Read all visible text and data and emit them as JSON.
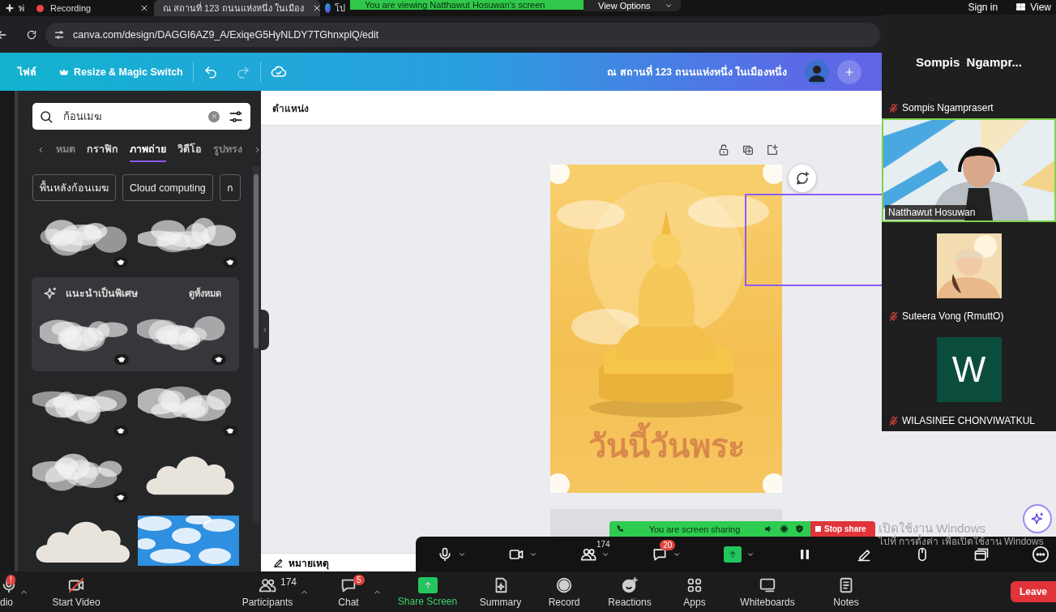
{
  "browser": {
    "tabs": [
      {
        "label": "พ่",
        "selected": false
      },
      {
        "label": "ณ สถานที่ 123 ถนนแห่งหนึ่ง ในเมือง",
        "selected": true
      },
      {
        "label": "โป",
        "selected": false
      }
    ],
    "recording": "Recording",
    "address": "canva.com/design/DAGGI6AZ9_A/ExiqeG5HyNLDY7TGhnxplQ/edit"
  },
  "viewing_banner": {
    "text": "You are viewing Natthawut Hosuwan's screen",
    "options": "View Options"
  },
  "canva_header": {
    "menu": "ไฟล์",
    "resize": "Resize & Magic Switch",
    "title": "ณ สถานที่ 123 ถนนแห่งหนึ่ง ในเมืองหนึ่ง"
  },
  "panel": {
    "search": "ก้อนเมฆ",
    "categories": [
      {
        "label": "หมด",
        "selected": false
      },
      {
        "label": "กราฟิก",
        "selected": false
      },
      {
        "label": "ภาพถ่าย",
        "selected": true
      },
      {
        "label": "วิดีโอ",
        "selected": false
      },
      {
        "label": "รูปทรง",
        "selected": false
      }
    ],
    "chips": [
      "พื้นหลังก้อนเมฆ",
      "Cloud computing",
      "ก"
    ],
    "results_top": [
      {
        "kind": "cloud",
        "premium": true
      },
      {
        "kind": "cloud",
        "premium": true
      }
    ],
    "featured": {
      "title": "แนะนำเป็นพิเศษ",
      "see_all": "ดูทั้งหมด",
      "results": [
        {
          "kind": "cloud",
          "premium": true
        },
        {
          "kind": "cloud",
          "premium": true
        }
      ]
    },
    "results": [
      {
        "kind": "cloud",
        "premium": true
      },
      {
        "kind": "cloud",
        "premium": true
      },
      {
        "kind": "cloud",
        "premium": true
      },
      {
        "kind": "shape",
        "premium": false
      },
      {
        "kind": "shape",
        "premium": false
      },
      {
        "kind": "sky",
        "premium": false
      }
    ]
  },
  "canvas": {
    "toolbar_label": "ตำแหน่ง",
    "poster_title": "วันนี้วันพระ",
    "notes": "หมายเหตุ"
  },
  "gallery": {
    "header": [
      "Sign in",
      "View"
    ],
    "tiles": [
      {
        "kind": "name",
        "display": "Sompis  Ngampr...",
        "name": "Sompis Ngamprasert",
        "muted": true,
        "speaking": false
      },
      {
        "kind": "video",
        "name": "Natthawut Hosuwan",
        "muted": false,
        "speaking": true
      },
      {
        "kind": "avatar",
        "name": "Suteera Vong (RmuttO)",
        "muted": true,
        "speaking": false
      },
      {
        "kind": "initial",
        "initial": "W",
        "name": "WILASINEE CHONVIWATKUL",
        "muted": true,
        "speaking": false
      }
    ]
  },
  "share_toolbar": {
    "items": [
      {
        "kind": "mic"
      },
      {
        "kind": "video"
      },
      {
        "kind": "participants",
        "count": "174"
      },
      {
        "kind": "chat",
        "badge": "20"
      },
      {
        "kind": "share"
      },
      {
        "kind": "pause"
      },
      {
        "kind": "annotate"
      },
      {
        "kind": "remote"
      },
      {
        "kind": "window"
      },
      {
        "kind": "more"
      }
    ]
  },
  "share_banner": {
    "text": "You are screen sharing",
    "stop": "Stop share"
  },
  "activation": [
    "เปิดใช้งาน Windows",
    "ไปที่ การตั้งค่า เพื่อเปิดใช้งาน Windows"
  ],
  "meeting_controls": [
    {
      "kind": "audio",
      "label": "dio",
      "badge": "!"
    },
    {
      "kind": "video",
      "label": "Start Video"
    },
    {
      "kind": "participants",
      "label": "Participants",
      "count": "174"
    },
    {
      "kind": "chat",
      "label": "Chat",
      "badge": "5"
    },
    {
      "kind": "share",
      "label": "Share Screen"
    },
    {
      "kind": "summary",
      "label": "Summary"
    },
    {
      "kind": "record",
      "label": "Record"
    },
    {
      "kind": "reactions",
      "label": "Reactions"
    },
    {
      "kind": "apps",
      "label": "Apps"
    },
    {
      "kind": "whiteboards",
      "label": "Whiteboards"
    },
    {
      "kind": "notes",
      "label": "Notes"
    }
  ],
  "leave": "Leave"
}
